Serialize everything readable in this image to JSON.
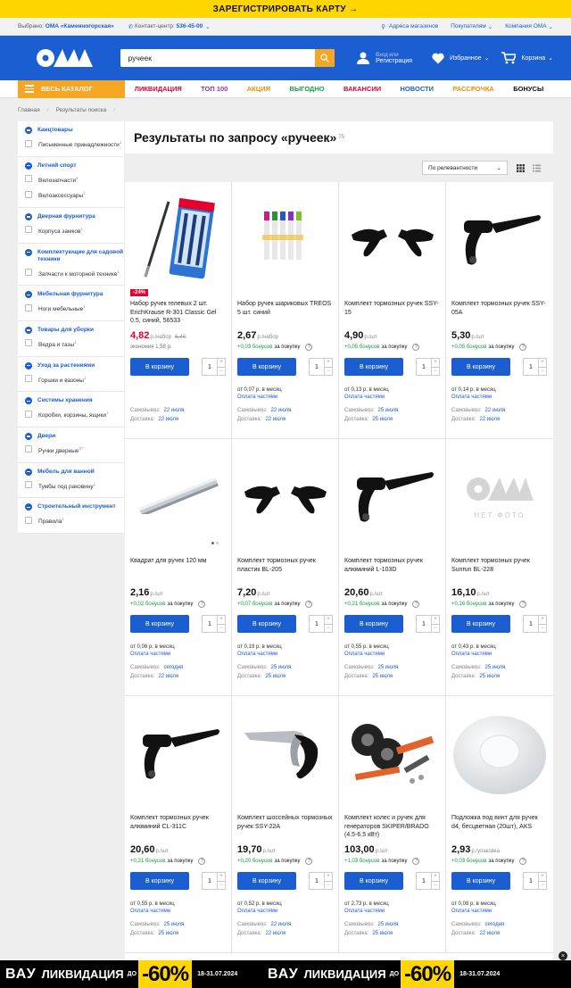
{
  "promo_top": "ЗАРЕГИСТРИРОВАТЬ КАРТУ",
  "topbar": {
    "selected_prefix": "Выбрано:",
    "selected_store": "ОМА «Каменногорская»",
    "contact_prefix": "Контакт-центр:",
    "contact_phone": "536-45-00",
    "links": [
      "Адреса магазинов",
      "Покупателям",
      "Компания ОМА"
    ]
  },
  "header": {
    "search_value": "ручеек",
    "login_small": "Вход или",
    "login_label": "Регистрация",
    "favorites": "Избранное",
    "cart": "Корзина"
  },
  "nav": {
    "catalog": "ВЕСЬ КАТАЛОГ",
    "items": [
      {
        "label": "ЛИКВИДАЦИЯ",
        "color": "#e4002b"
      },
      {
        "label": "ТОП 100",
        "color": "#9b2fae"
      },
      {
        "label": "АКЦИЯ",
        "color": "#f08c00"
      },
      {
        "label": "ВЫГОДНО",
        "color": "#1a9e3f"
      },
      {
        "label": "ВАКАНСИИ",
        "color": "#e4002b"
      },
      {
        "label": "НОВОСТИ",
        "color": "#1b5ed1"
      },
      {
        "label": "РАССРОЧКА",
        "color": "#f08c00"
      },
      {
        "label": "БОНУСЫ",
        "color": "#111111"
      }
    ]
  },
  "breadcrumbs": [
    "Главная",
    "Результаты поиска"
  ],
  "sidebar": [
    {
      "title": "Канцтовары",
      "items": [
        {
          "label": "Письменные принадлежности",
          "count": "1"
        }
      ]
    },
    {
      "title": "Летний спорт",
      "items": [
        {
          "label": "Велозапчасти",
          "count": "6"
        },
        {
          "label": "Велоаксессуары",
          "count": "1"
        }
      ]
    },
    {
      "title": "Дверная фурнитура",
      "items": [
        {
          "label": "Корпуса замков",
          "count": "1"
        }
      ]
    },
    {
      "title": "Комплектующие для садовой техники",
      "items": [
        {
          "label": "Запчасти к моторной технике",
          "count": "1"
        }
      ]
    },
    {
      "title": "Мебельная фурнитура",
      "items": [
        {
          "label": "Ноги мебельные",
          "count": "1"
        }
      ]
    },
    {
      "title": "Товары для уборки",
      "items": [
        {
          "label": "Ведра и тазы",
          "count": "1"
        }
      ]
    },
    {
      "title": "Уход за растениями",
      "items": [
        {
          "label": "Горшки и вазоны",
          "count": "1"
        }
      ]
    },
    {
      "title": "Системы хранения",
      "items": [
        {
          "label": "Коробки, корзины, ящики",
          "count": "1"
        }
      ]
    },
    {
      "title": "Двери",
      "items": [
        {
          "label": "Ручки дверные",
          "count": "57"
        }
      ]
    },
    {
      "title": "Мебель для ванной",
      "items": [
        {
          "label": "Тумбы под раковину",
          "count": "1"
        }
      ]
    },
    {
      "title": "Строительный инструмент",
      "items": [
        {
          "label": "Правила",
          "count": "1"
        }
      ]
    }
  ],
  "results": {
    "title": "Результаты по запросу «ручеек»",
    "count": "75",
    "sort": "По релевантности"
  },
  "labels": {
    "buy": "В корзину",
    "bonus_suffix": "за покупку",
    "pickup": "Самовывоз:",
    "delivery": "Доставка:",
    "parts": "Оплата частями",
    "qty": "1"
  },
  "products": [
    {
      "name": "Набор ручек гелевых 2 шт. ErichKrause R-301 Classic Gel 0.5, синий, 56533",
      "price": "4,82",
      "unit": "р./набор",
      "old": "6,40",
      "sale": true,
      "discount": "-24%",
      "econ": "экономия 1,58 р.",
      "bonus": "",
      "inst": "",
      "pickup": "22 июля",
      "delivery": "22 июля",
      "img": "pens"
    },
    {
      "name": "Набор ручек шариковых TREOS 5 шт. синий",
      "price": "2,67",
      "unit": "р./набор",
      "old": "",
      "sale": false,
      "discount": "",
      "econ": "",
      "bonus": "+0,03 бонусов",
      "inst": "от 0,07 р. в месяц",
      "pickup": "22 июля",
      "delivery": "22 июля",
      "img": "markers"
    },
    {
      "name": "Комплект тормозных ручек SSY-15",
      "price": "4,90",
      "unit": "р./шт",
      "old": "",
      "sale": false,
      "discount": "",
      "econ": "",
      "bonus": "+0,05 бонусов",
      "inst": "от 0,13 р. в месяц",
      "pickup": "25 июля",
      "delivery": "25 июля",
      "img": "brake2"
    },
    {
      "name": "Комплект тормозных ручек SSY-05A",
      "price": "5,30",
      "unit": "р./шт",
      "old": "",
      "sale": false,
      "discount": "",
      "econ": "",
      "bonus": "+0,05 бонусов",
      "inst": "от 0,14 р. в месяц",
      "pickup": "22 июля",
      "delivery": "22 июля",
      "img": "brake1"
    },
    {
      "name": "Квадрат для ручек 120 мм",
      "price": "2,16",
      "unit": "р./шт",
      "old": "",
      "sale": false,
      "discount": "",
      "econ": "",
      "bonus": "+0,02 бонусов",
      "inst": "от 0,06 р. в месяц",
      "pickup": "сегодня",
      "delivery": "22 июля",
      "img": "rod"
    },
    {
      "name": "Комплект тормозных ручек пластик BL-205",
      "price": "7,20",
      "unit": "р./шт",
      "old": "",
      "sale": false,
      "discount": "",
      "econ": "",
      "bonus": "+0,07 бонусов",
      "inst": "от 0,19 р. в месяц",
      "pickup": "25 июля",
      "delivery": "25 июля",
      "img": "brake2"
    },
    {
      "name": "Комплект тормозных ручек алюминий L-103D",
      "price": "20,60",
      "unit": "р./шт",
      "old": "",
      "sale": false,
      "discount": "",
      "econ": "",
      "bonus": "+0,21 бонусов",
      "inst": "от 0,55 р. в месяц",
      "pickup": "25 июля",
      "delivery": "25 июля",
      "img": "brake1"
    },
    {
      "name": "Комплект тормозных ручек Sunrun BL-228",
      "price": "16,10",
      "unit": "р./шт",
      "old": "",
      "sale": false,
      "discount": "",
      "econ": "",
      "bonus": "+0,16 бонусов",
      "inst": "от 0,43 р. в месяц",
      "pickup": "25 июля",
      "delivery": "25 июля",
      "img": "nophoto"
    },
    {
      "name": "Комплект тормозных ручек алюминий CL-311C",
      "price": "20,60",
      "unit": "р./шт",
      "old": "",
      "sale": false,
      "discount": "",
      "econ": "",
      "bonus": "+0,21 бонусов",
      "inst": "от 0,55 р. в месяц",
      "pickup": "25 июля",
      "delivery": "25 июля",
      "img": "brake1"
    },
    {
      "name": "Комплект шоссейных тормозных ручек SSY-22A",
      "price": "19,70",
      "unit": "р./шт",
      "old": "",
      "sale": false,
      "discount": "",
      "econ": "",
      "bonus": "+0,20 бонусов",
      "inst": "от 0,52 р. в месяц",
      "pickup": "22 июля",
      "delivery": "22 июля",
      "img": "road"
    },
    {
      "name": "Комплект колес и ручек для генераторов SKIPER/BRADO (4.5-6.5 кВт)",
      "price": "103,00",
      "unit": "р./шт",
      "old": "",
      "sale": false,
      "discount": "",
      "econ": "",
      "bonus": "+1,03 бонусов",
      "inst": "от 2,73 р. в месяц",
      "pickup": "25 июля",
      "delivery": "25 июля",
      "img": "wheels"
    },
    {
      "name": "Подложка под винт для ручек d4, бесцветная (20шт), AKS",
      "price": "2,93",
      "unit": "р./упаковка",
      "old": "",
      "sale": false,
      "discount": "",
      "econ": "",
      "bonus": "+0,03 бонусов",
      "inst": "от 0,08 р. в месяц",
      "pickup": "сегодня",
      "delivery": "22 июля",
      "img": "pad"
    }
  ],
  "nophoto_text": "НЕТ ФОТО",
  "banner": {
    "vau": "ВАУ",
    "liq": "ЛИКВИДАЦИЯ",
    "do": "ДО",
    "pct": "-60%",
    "dates": "18-31.07.2024"
  }
}
